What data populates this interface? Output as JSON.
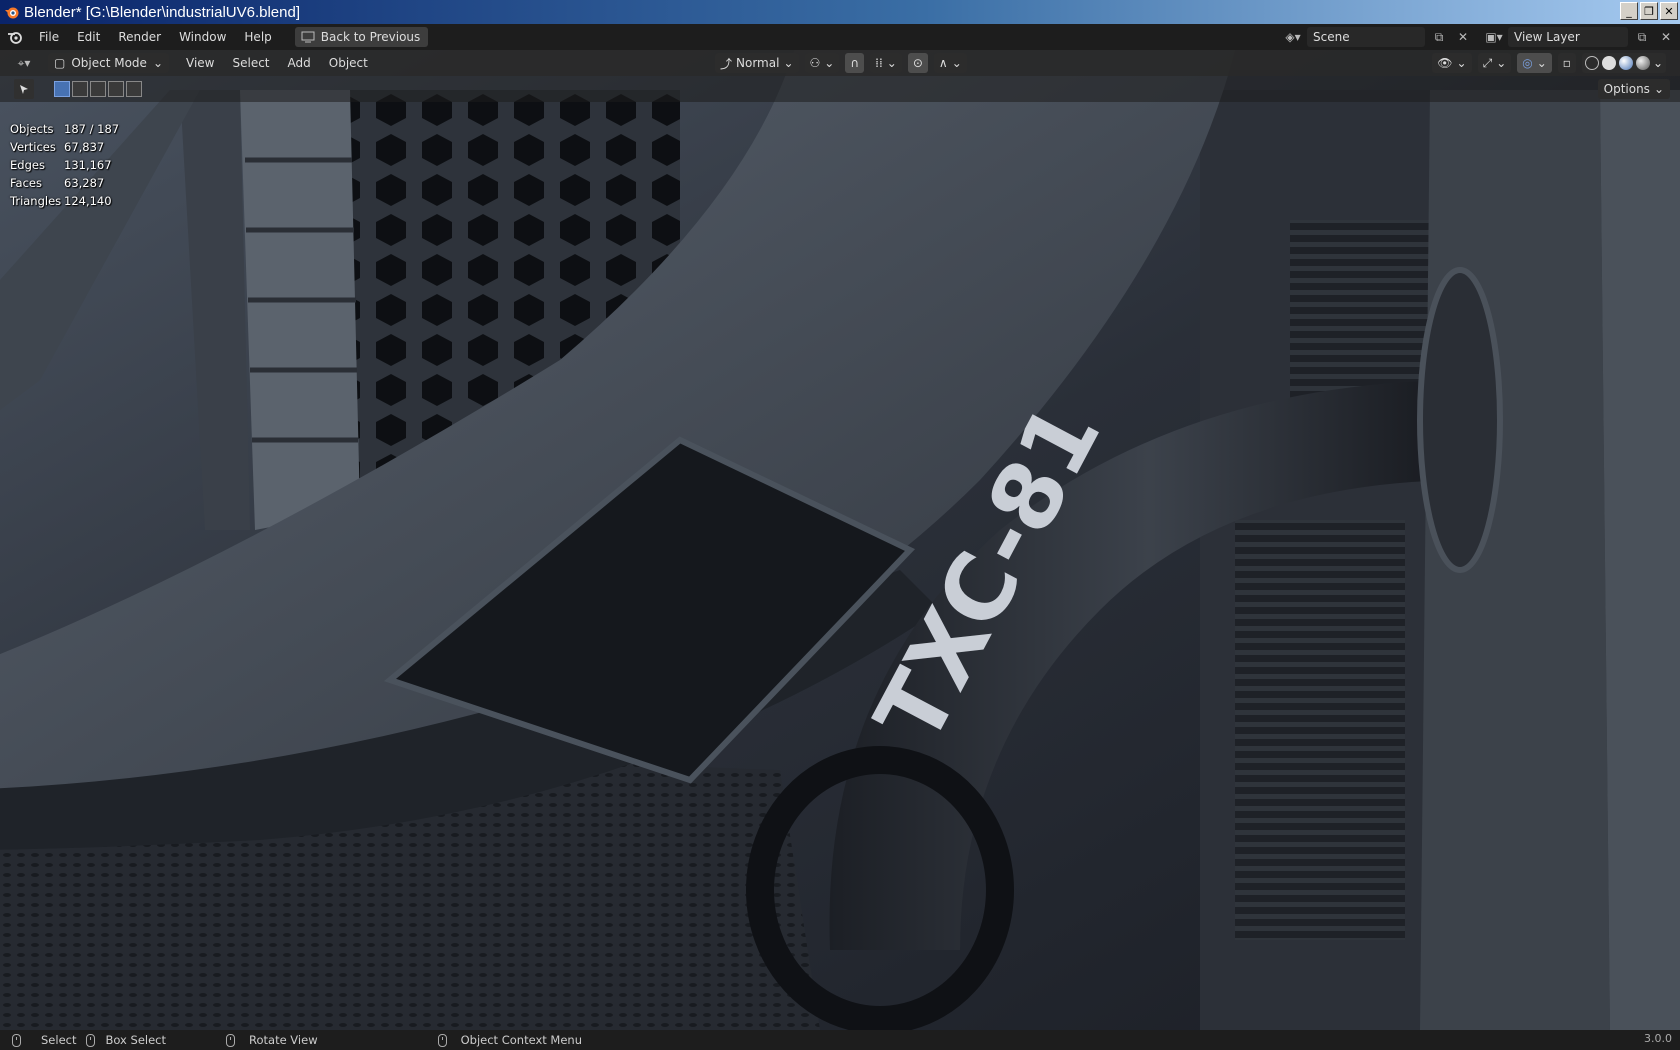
{
  "window": {
    "title": "Blender* [G:\\Blender\\industrialUV6.blend]",
    "controls": [
      "_",
      "❐",
      "✕"
    ]
  },
  "menubar": {
    "items": [
      "File",
      "Edit",
      "Render",
      "Window",
      "Help"
    ],
    "back_button": "Back to Previous",
    "scene": "Scene",
    "view_layer": "View Layer"
  },
  "header": {
    "mode": "Object Mode",
    "menus": [
      "View",
      "Select",
      "Add",
      "Object"
    ],
    "orientation": "Normal"
  },
  "toolbar": {
    "options": "Options"
  },
  "stats": [
    {
      "label": "Objects",
      "value": "187 / 187"
    },
    {
      "label": "Vertices",
      "value": "67,837"
    },
    {
      "label": "Edges",
      "value": "131,167"
    },
    {
      "label": "Faces",
      "value": "63,287"
    },
    {
      "label": "Triangles",
      "value": "124,140"
    }
  ],
  "scene_label": "TXC-81",
  "statusbar": {
    "select": "Select",
    "box_select": "Box Select",
    "rotate_view": "Rotate View",
    "context_menu": "Object Context Menu",
    "version": "3.0.0"
  },
  "colors": {
    "accent": "#4772b3",
    "panel": "#1d1d1d",
    "header": "#282828"
  }
}
